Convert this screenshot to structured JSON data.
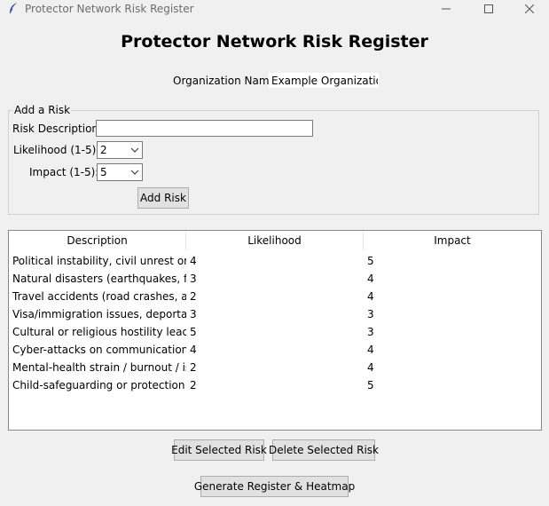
{
  "window": {
    "title": "Protector Network Risk Register"
  },
  "heading": "Protector Network Risk Register",
  "organization": {
    "label": "Organization Name:",
    "value": "Example Organization"
  },
  "add_risk": {
    "group_label": "Add a Risk",
    "description_label": "Risk Description:",
    "description_value": "",
    "likelihood_label": "Likelihood (1-5):",
    "likelihood_value": "2",
    "impact_label": "Impact (1-5):",
    "impact_value": "5",
    "add_button": "Add Risk"
  },
  "table": {
    "columns": [
      "Description",
      "Likelihood",
      "Impact"
    ],
    "rows": [
      {
        "description": "Political instability, civil unrest or arn",
        "likelihood": "4",
        "impact": "5"
      },
      {
        "description": "Natural disasters (earthquakes, flood",
        "likelihood": "3",
        "impact": "4"
      },
      {
        "description": "Travel accidents (road crashes, air m",
        "likelihood": "2",
        "impact": "4"
      },
      {
        "description": "Visa/immigration issues, deportation",
        "likelihood": "3",
        "impact": "3"
      },
      {
        "description": "Cultural or religious hostility leading",
        "likelihood": "5",
        "impact": "3"
      },
      {
        "description": "Cyber-attacks on communications o",
        "likelihood": "4",
        "impact": "4"
      },
      {
        "description": "Mental-health strain / burnout / isol",
        "likelihood": "2",
        "impact": "4"
      },
      {
        "description": "Child-safeguarding or protection fail",
        "likelihood": "2",
        "impact": "5"
      }
    ]
  },
  "actions": {
    "edit": "Edit Selected Risk",
    "delete": "Delete Selected Risk",
    "generate": "Generate Register & Heatmap"
  }
}
